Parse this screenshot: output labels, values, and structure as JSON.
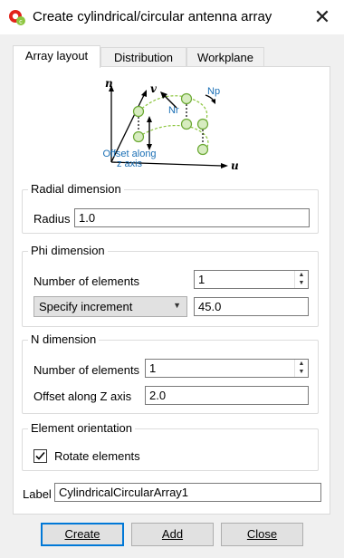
{
  "window": {
    "title": "Create cylindrical/circular antenna array",
    "close_symbol": "✕",
    "app_icon": "cadfeko-icon"
  },
  "tabs": [
    {
      "label": "Array layout",
      "active": true
    },
    {
      "label": "Distribution",
      "active": false
    },
    {
      "label": "Workplane",
      "active": false
    }
  ],
  "diagram": {
    "axis_n": "n",
    "axis_v": "v",
    "axis_u": "u",
    "nr_label": "Nr",
    "np_label": "Np",
    "offset_label_line1": "Offset along",
    "offset_label_line2": "z axis",
    "accent_color": "#1a6fb5",
    "element_color": "#8dc63f"
  },
  "radial": {
    "title": "Radial dimension",
    "radius_label": "Radius",
    "radius_value": "1.0"
  },
  "phi": {
    "title": "Phi dimension",
    "num_label": "Number of elements",
    "num_value": "1",
    "mode_value": "Specify increment",
    "increment_value": "45.0"
  },
  "n_dim": {
    "title": "N dimension",
    "num_label": "Number of elements",
    "num_value": "1",
    "offset_label": "Offset along Z axis",
    "offset_value": "2.0"
  },
  "orientation": {
    "title": "Element orientation",
    "rotate_label": "Rotate elements",
    "rotate_checked": true
  },
  "label_field": {
    "label": "Label",
    "value": "CylindricalCircularArray1"
  },
  "buttons": {
    "create": "Create",
    "add": "Add",
    "close": "Close"
  }
}
